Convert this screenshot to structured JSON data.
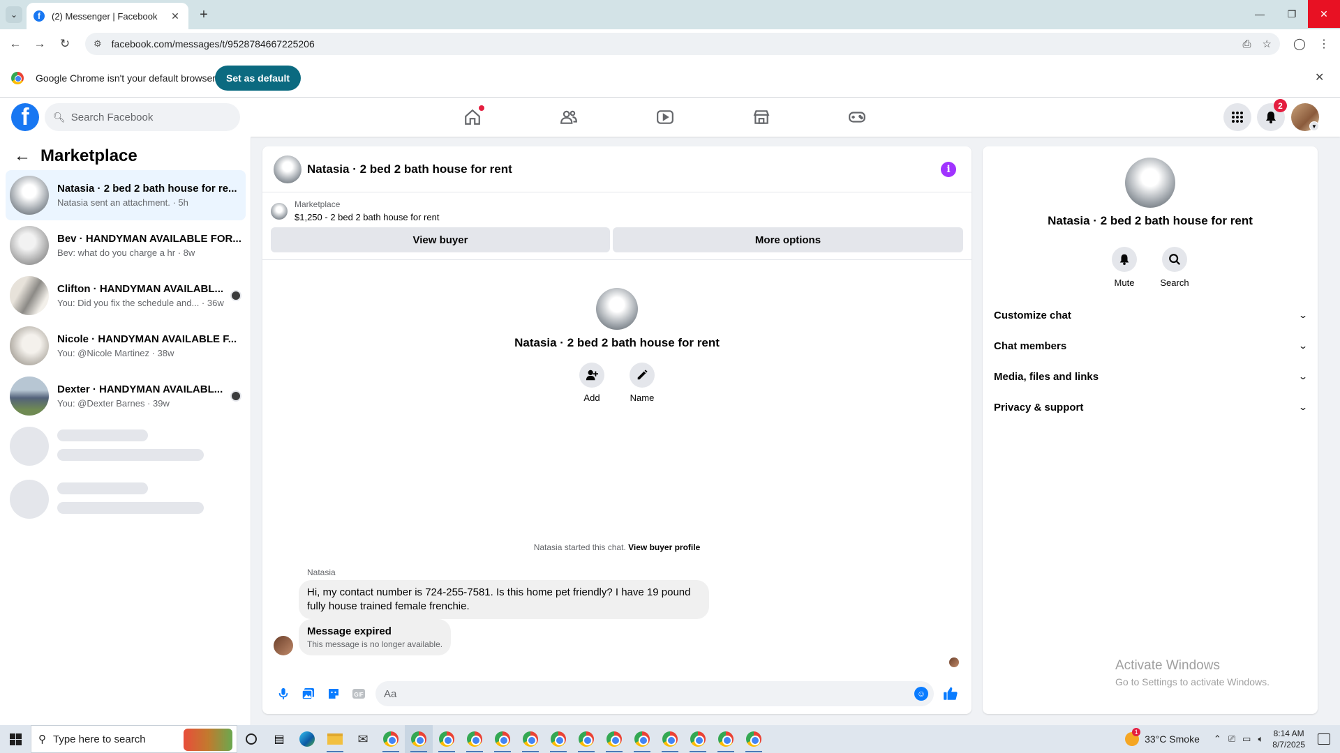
{
  "browser": {
    "tab_title": "(2) Messenger | Facebook",
    "url": "facebook.com/messages/t/9528784667225206",
    "infobar_text": "Google Chrome isn't your default browser",
    "infobar_button": "Set as default"
  },
  "fb_header": {
    "search_placeholder": "Search Facebook",
    "notification_count": "2",
    "nav_icons": [
      "home-icon",
      "friends-icon",
      "watch-icon",
      "marketplace-icon",
      "gaming-icon"
    ]
  },
  "sidebar": {
    "title": "Marketplace",
    "conversations": [
      {
        "name": "Natasia · 2 bed 2 bath house for re...",
        "preview": "Natasia sent an attachment. · 5h",
        "active": true
      },
      {
        "name": "Bev · HANDYMAN AVAILABLE FOR...",
        "preview": "Bev: what do you charge a hr · 8w",
        "active": false
      },
      {
        "name": "Clifton · HANDYMAN AVAILABL...",
        "preview": "You: Did you fix the schedule and... · 36w",
        "active": false
      },
      {
        "name": "Nicole · HANDYMAN AVAILABLE F...",
        "preview": "You: @Nicole Martinez · 38w",
        "active": false
      },
      {
        "name": "Dexter · HANDYMAN AVAILABL...",
        "preview": "You: @Dexter Barnes · 39w",
        "active": false
      }
    ]
  },
  "chat": {
    "title": "Natasia · 2 bed 2 bath house for rent",
    "marketplace_label": "Marketplace",
    "listing": "$1,250 - 2 bed 2 bath house for rent",
    "view_buyer": "View buyer",
    "more_options": "More options",
    "center_title": "Natasia · 2 bed 2 bath house for rent",
    "add_label": "Add",
    "name_label": "Name",
    "started_text": "Natasia started this chat.",
    "view_buyer_profile": "View buyer profile",
    "sender": "Natasia",
    "message_line1": "Hi, my contact number is 724-255-7581. Is this home pet friendly? I have 19 pound",
    "message_line2": "fully house trained female frenchie.",
    "expired_title": "Message expired",
    "expired_sub": "This message is no longer available.",
    "composer_placeholder": "Aa"
  },
  "info_panel": {
    "title": "Natasia · 2 bed 2 bath house for rent",
    "mute": "Mute",
    "search": "Search",
    "sections": [
      "Customize chat",
      "Chat members",
      "Media, files and links",
      "Privacy & support"
    ]
  },
  "watermark": {
    "line1": "Activate Windows",
    "line2": "Go to Settings to activate Windows."
  },
  "taskbar": {
    "search_placeholder": "Type here to search",
    "weather": "33°C  Smoke",
    "weather_badge": "1",
    "time": "8:14 AM",
    "date": "8/7/2025"
  }
}
